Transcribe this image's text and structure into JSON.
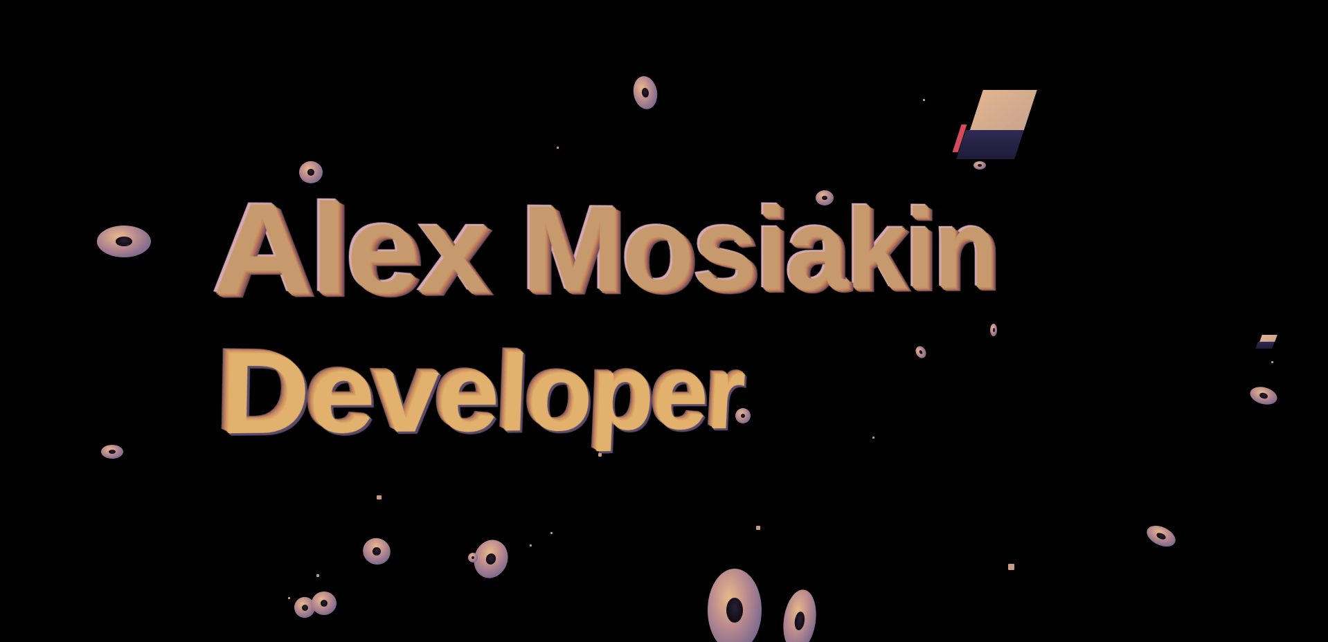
{
  "scene": {
    "background": "#000000",
    "headline": {
      "name": "Alex Mosiakin",
      "role": "Developer"
    },
    "palette": {
      "face_purple": "#8a7f9b",
      "bevel_orange": "#e2b16d",
      "bevel_red": "#d44a5a",
      "shadow_navy": "#2f2a52"
    },
    "decorations": {
      "torus_shape": "donut",
      "cube_shape": "box"
    }
  }
}
